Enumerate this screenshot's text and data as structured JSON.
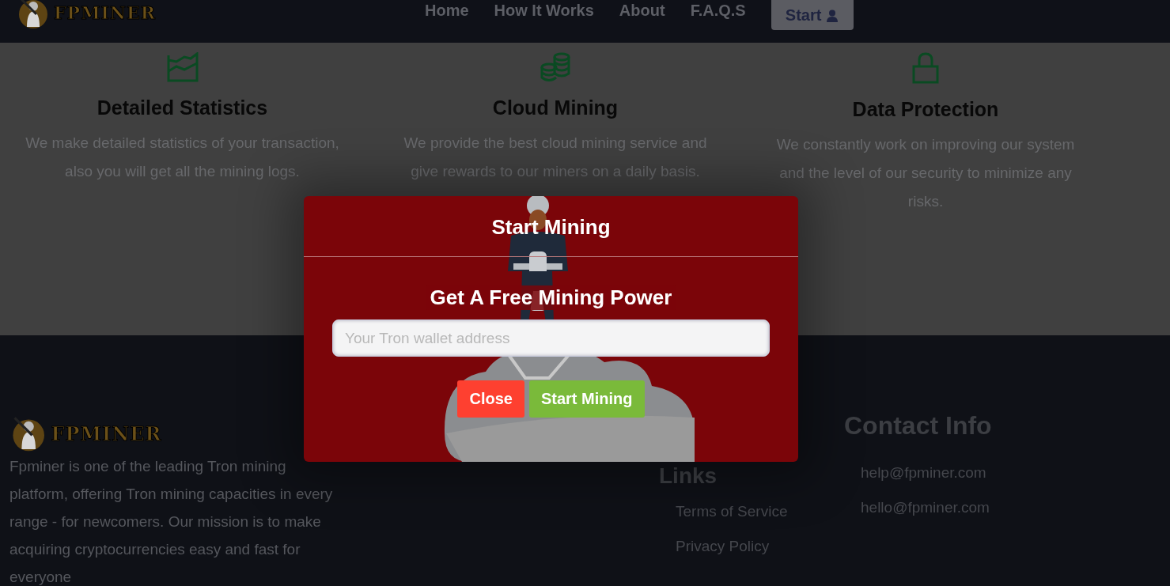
{
  "header": {
    "logo": "FPMINER",
    "nav": [
      {
        "label": "Home"
      },
      {
        "label": "How It Works"
      },
      {
        "label": "About"
      },
      {
        "label": "F.A.Q.S"
      }
    ],
    "start_button": "Start"
  },
  "features": [
    {
      "kind": "chart",
      "title": "Detailed Statistics",
      "text": "We make detailed statistics of your transaction, also you will get all the mining logs."
    },
    {
      "kind": "coins",
      "title": "Cloud Mining",
      "text": "We provide the best cloud mining service and give rewards to our miners on a daily basis."
    },
    {
      "kind": "lock",
      "title": "Data Protection",
      "text": "We constantly work on improving our system and the level of our security to minimize any risks."
    }
  ],
  "modal": {
    "title": "Start Mining",
    "heading": "Get A Free Mining Power",
    "wallet_field": {
      "placeholder": "Your Tron wallet address"
    },
    "buttons": [
      {
        "label": "Close",
        "kind": "danger"
      },
      {
        "label": "Start Mining",
        "kind": "success"
      }
    ]
  },
  "footer": {
    "logo": "FPMINER",
    "about": "Fpminer is one of the leading Tron mining platform, offering Tron mining capacities in every range - for newcomers. Our mission is to make acquiring cryptocurrencies easy and fast for everyone",
    "links_title": "Links",
    "links": [
      "Terms of Service",
      "Privacy Policy"
    ],
    "contact_title": "Contact Info",
    "contacts": [
      "help@fpminer.com",
      "hello@fpminer.com"
    ]
  }
}
